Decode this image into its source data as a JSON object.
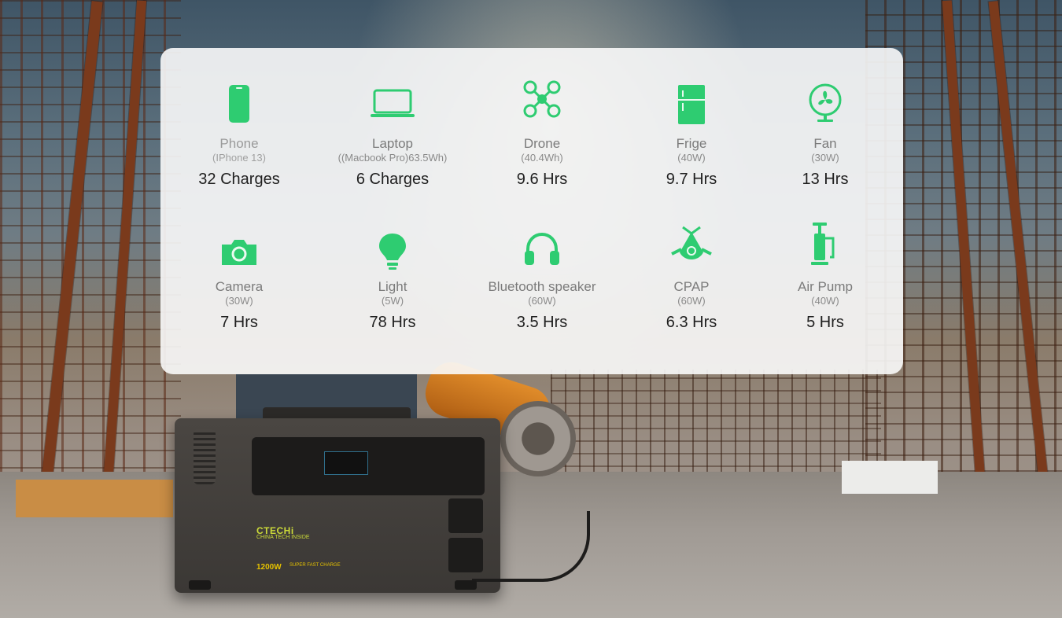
{
  "colors": {
    "accent": "#2ecc71",
    "card_bg": "#fafafa",
    "label": "#7b7b7b",
    "value": "#1f1f1f"
  },
  "devices": [
    {
      "icon": "phone-icon",
      "name": "Phone",
      "spec": "(IPhone 13)",
      "value": "32 Charges"
    },
    {
      "icon": "laptop-icon",
      "name": "Laptop",
      "spec": "((Macbook Pro)63.5Wh)",
      "value": "6 Charges"
    },
    {
      "icon": "drone-icon",
      "name": "Drone",
      "spec": "(40.4Wh)",
      "value": "9.6 Hrs"
    },
    {
      "icon": "fridge-icon",
      "name": "Frige",
      "spec": "(40W)",
      "value": "9.7 Hrs"
    },
    {
      "icon": "fan-icon",
      "name": "Fan",
      "spec": "(30W)",
      "value": "13 Hrs"
    },
    {
      "icon": "camera-icon",
      "name": "Camera",
      "spec": "(30W)",
      "value": "7 Hrs"
    },
    {
      "icon": "light-bulb-icon",
      "name": "Light",
      "spec": "(5W)",
      "value": "78 Hrs"
    },
    {
      "icon": "headphones-icon",
      "name": "Bluetooth speaker",
      "spec": "(60W)",
      "value": "3.5 Hrs"
    },
    {
      "icon": "cpap-icon",
      "name": "CPAP",
      "spec": "(60W)",
      "value": "6.3 Hrs"
    },
    {
      "icon": "air-pump-icon",
      "name": "Air Pump",
      "spec": "(40W)",
      "value": "5 Hrs"
    }
  ],
  "product": {
    "brand": "CTECHi",
    "tagline": "CHINA TECH INSIDE",
    "wattage": "1200W",
    "feature": "SUPER FAST CHARGE"
  }
}
